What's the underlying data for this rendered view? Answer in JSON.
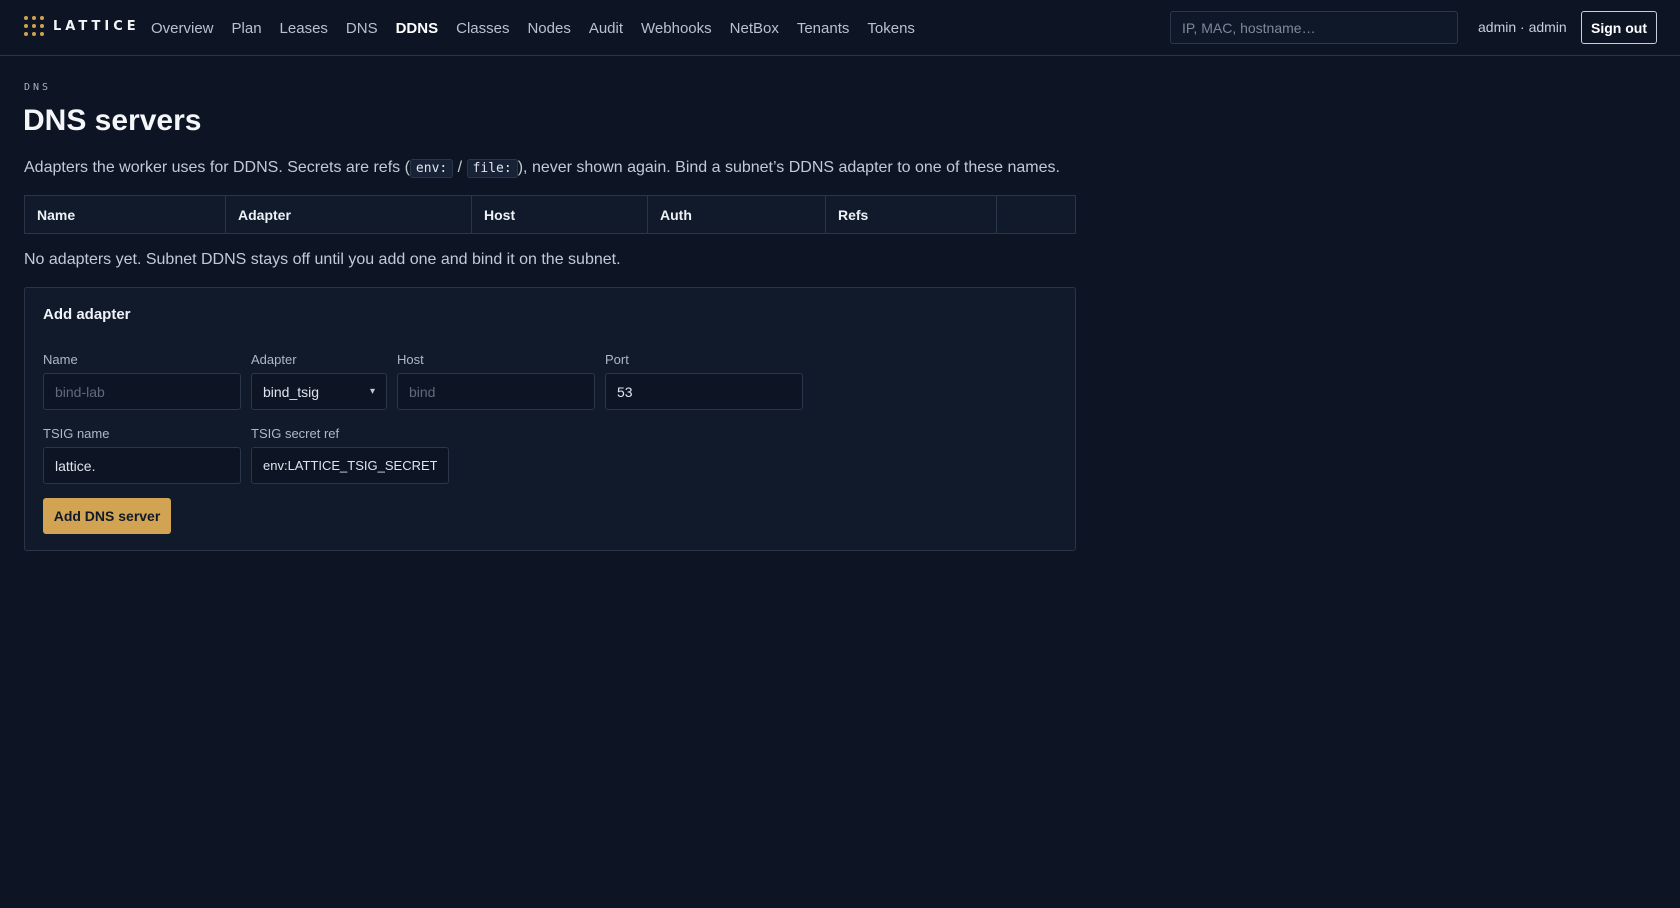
{
  "app": {
    "name": "LATTICE"
  },
  "nav": {
    "items": [
      {
        "label": "Overview",
        "active": false
      },
      {
        "label": "Plan",
        "active": false
      },
      {
        "label": "Leases",
        "active": false
      },
      {
        "label": "DNS",
        "active": false
      },
      {
        "label": "DDNS",
        "active": true
      },
      {
        "label": "Classes",
        "active": false
      },
      {
        "label": "Nodes",
        "active": false
      },
      {
        "label": "Audit",
        "active": false
      },
      {
        "label": "Webhooks",
        "active": false
      },
      {
        "label": "NetBox",
        "active": false
      },
      {
        "label": "Tenants",
        "active": false
      },
      {
        "label": "Tokens",
        "active": false
      }
    ]
  },
  "search": {
    "placeholder": "IP, MAC, hostname…",
    "value": ""
  },
  "user": {
    "label": "admin · admin"
  },
  "signout": {
    "label": "Sign out"
  },
  "page": {
    "breadcrumb": "DNS",
    "title": "DNS servers",
    "intro_before": "Adapters the worker uses for DDNS. Secrets are refs (",
    "code_env": "env:",
    "sep": " / ",
    "code_file": "file:",
    "intro_after": "), never shown again. Bind a subnet’s DDNS adapter to one of these names."
  },
  "table": {
    "columns": [
      "Name",
      "Adapter",
      "Host",
      "Auth",
      "Refs",
      ""
    ],
    "rows": [],
    "empty_text": "No adapters yet. Subnet DDNS stays off until you add one and bind it on the subnet."
  },
  "form": {
    "title": "Add adapter",
    "name": {
      "label": "Name",
      "placeholder": "bind-lab",
      "value": ""
    },
    "adapter": {
      "label": "Adapter",
      "value": "bind_tsig"
    },
    "host": {
      "label": "Host",
      "placeholder": "bind",
      "value": ""
    },
    "port": {
      "label": "Port",
      "value": "53"
    },
    "tsig_name": {
      "label": "TSIG name",
      "value": "lattice."
    },
    "tsig_secret": {
      "label": "TSIG secret ref",
      "value": "env:LATTICE_TSIG_SECRET"
    },
    "submit": {
      "label": "Add DNS server"
    }
  },
  "colors": {
    "background": "#0d1525",
    "accent": "#d1a353",
    "border": "#2a3548"
  }
}
